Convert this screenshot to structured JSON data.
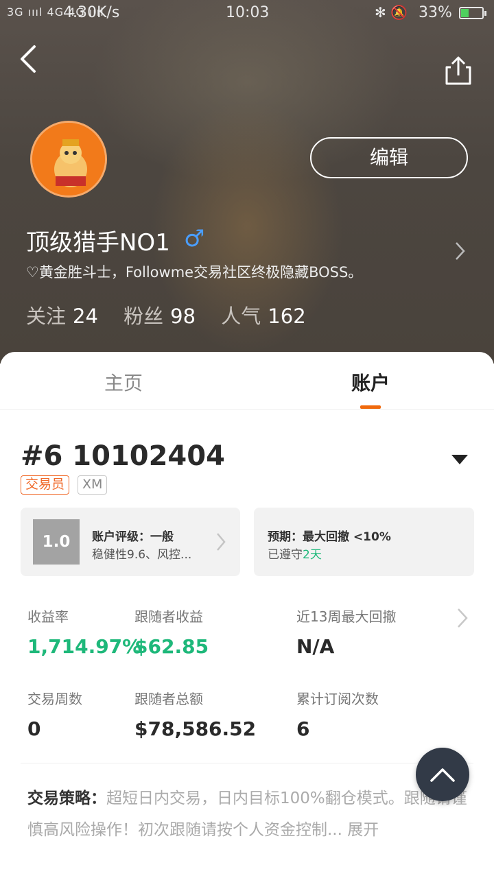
{
  "status_bar": {
    "signal": "3G ıııl 4G 4G ıııl",
    "speed": "4.30K/s",
    "time": "10:03",
    "icons": "✻ 🔕",
    "battery_text": "33%",
    "battery_level": 0.33
  },
  "header": {
    "back_icon": "chevron-left-icon",
    "share_icon": "share-icon",
    "edit_label": "编辑",
    "username": "顶级猎手NO1",
    "gender_symbol": "♂",
    "bio": "♡黄金胜斗士，Followme交易社区终极隐藏BOSS。",
    "stats": [
      {
        "label": "关注",
        "value": "24"
      },
      {
        "label": "粉丝",
        "value": "98"
      },
      {
        "label": "人气",
        "value": "162"
      }
    ]
  },
  "tabs": {
    "home": "主页",
    "account": "账户"
  },
  "account": {
    "id": "#6 10102404",
    "role_badge": "交易员",
    "broker_badge": "XM",
    "rating": {
      "score": "1.0",
      "title": "账户评级：一般",
      "detail": "稳健性9.6、风控..."
    },
    "expectation": {
      "title": "预期：最大回撤 <10%",
      "detail_prefix": "已遵守",
      "detail_value": "2天"
    },
    "metrics": [
      {
        "label": "收益率",
        "value": "1,714.97%"
      },
      {
        "label": "跟随者收益",
        "value": "$62.85"
      },
      {
        "label": "近13周最大回撤",
        "value": "N/A"
      },
      {
        "label": "交易周数",
        "value": "0"
      },
      {
        "label": "跟随者总额",
        "value": "$78,586.52"
      },
      {
        "label": "累计订阅次数",
        "value": "6"
      }
    ],
    "strategy": {
      "label": "交易策略：",
      "text": "超短日内交易，日内目标100%翻仓模式。跟随请谨慎高风险操作！初次跟随请按个人资金控制...",
      "expand": "展开"
    }
  },
  "colors": {
    "accent_orange": "#f0690c",
    "gain_green": "#1eb87a",
    "gender_blue": "#4a9eff"
  }
}
